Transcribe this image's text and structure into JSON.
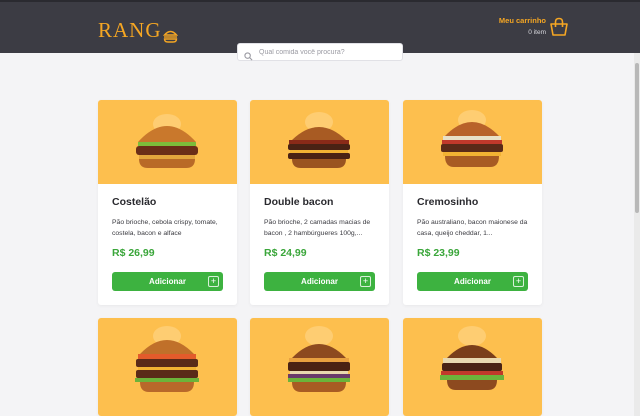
{
  "header": {
    "logo_text": "RANG",
    "logo_icon": "burger-icon",
    "cart_label": "Meu carrinho",
    "cart_count": "0 item",
    "cart_icon": "shopping-bag-icon"
  },
  "search": {
    "placeholder": "Qual comida você procura?",
    "icon": "search-icon"
  },
  "colors": {
    "header_bg": "#3c3c44",
    "accent": "#f5a623",
    "card_image_bg": "#fdbf4e",
    "price": "#3aa63a",
    "button": "#3db240"
  },
  "products": [
    {
      "name": "Costelão",
      "desc": "Pão brioche, cebola crispy, tomate, costela, bacon e alface",
      "price": "R$ 26,99",
      "button": "Adicionar"
    },
    {
      "name": "Double bacon",
      "desc": "Pão brioche, 2 camadas macias de bacon , 2 hambúrgueres 100g,...",
      "price": "R$ 24,99",
      "button": "Adicionar"
    },
    {
      "name": "Cremosinho",
      "desc": "Pão australiano, bacon maionese da casa, queijo cheddar, 1...",
      "price": "R$ 23,99",
      "button": "Adicionar"
    },
    {
      "name": "",
      "desc": "",
      "price": "",
      "button": ""
    },
    {
      "name": "",
      "desc": "",
      "price": "",
      "button": ""
    },
    {
      "name": "",
      "desc": "",
      "price": "",
      "button": ""
    }
  ]
}
